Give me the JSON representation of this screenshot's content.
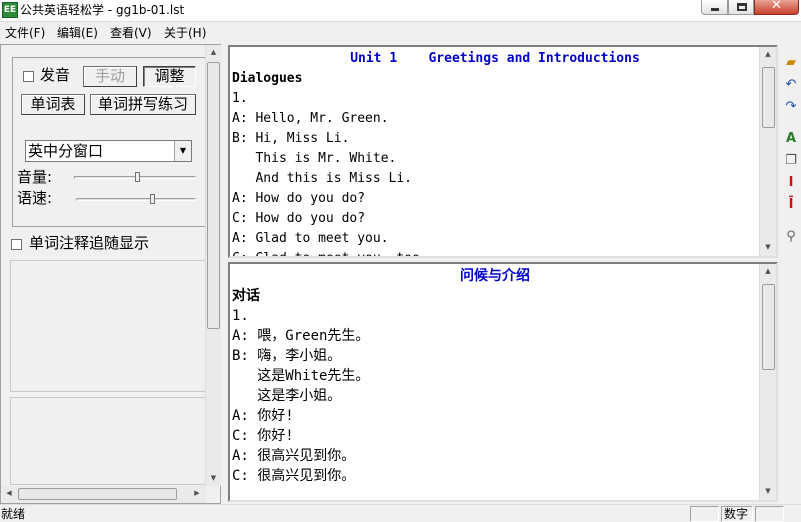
{
  "window": {
    "title": "公共英语轻松学 - gg1b-01.lst",
    "icon_label": "EE",
    "close_glyph": "✕"
  },
  "menu": [
    "文件(F)",
    "编辑(E)",
    "查看(V)",
    "关于(H)"
  ],
  "left": {
    "pronounce_label": "发音",
    "manual_button": "手动",
    "adjust_button": "调整",
    "word_list_button": "单词表",
    "spelling_button": "单词拼写练习",
    "window_mode": "英中分窗口",
    "volume_label": "音量:",
    "speed_label": "语速:",
    "volume_level": 0.5,
    "speed_level": 0.6,
    "annotation_label": "单词注释追随显示"
  },
  "english": {
    "title": "Unit 1    Greetings and Introductions",
    "lines": [
      "Dialogues",
      "1.",
      "A: Hello, Mr. Green.",
      "B: Hi, Miss Li.",
      "   This is Mr. White.",
      "   And this is Miss Li.",
      "A: How do you do?",
      "C: How do you do?",
      "A: Glad to meet you.",
      "C: Glad to meet you, too."
    ]
  },
  "chinese": {
    "title": "问候与介绍",
    "lines": [
      "对话",
      "1.",
      "A: 喂，Green先生。",
      "B: 嗨，李小姐。",
      "   这是White先生。",
      "   这是李小姐。",
      "A: 你好!",
      "C: 你好!",
      "A: 很高兴见到你。",
      "C: 很高兴见到你。"
    ]
  },
  "toolbar": [
    "open-folder-icon",
    "undo-icon",
    "redo-icon",
    "font-icon",
    "copy-icon",
    "text-cursor-icon",
    "text-cursor-down-icon",
    "search-icon"
  ],
  "status": {
    "ready": "就绪",
    "num": "数字"
  },
  "colors": {
    "heading": "#0000cc"
  }
}
